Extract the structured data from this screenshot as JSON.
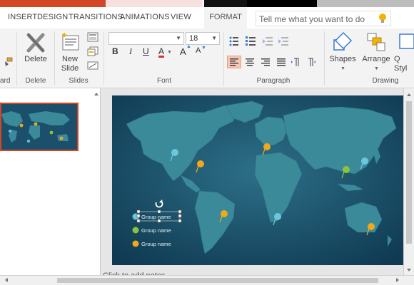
{
  "tabs": [
    "INSERT",
    "DESIGN",
    "TRANSITIONS",
    "ANIMATIONS",
    "VIEW"
  ],
  "active_tab": "FORMAT",
  "search": {
    "placeholder": "Tell me what you want to do"
  },
  "ribbon": {
    "clipboard_label": "ard",
    "delete_button": "Delete",
    "delete_group": "Delete",
    "new_slide_line1": "New",
    "new_slide_line2": "Slide",
    "slides_group": "Slides",
    "font_size": "18",
    "font_group": "Font",
    "bold": "B",
    "italic": "I",
    "underline": "U",
    "font_color": "A",
    "grow": "A",
    "shrink": "A",
    "paragraph_group": "Paragraph",
    "shapes": "Shapes",
    "arrange": "Arrange",
    "quick_styles": "Q\nStyl",
    "drawing_group": "Drawing"
  },
  "slide": {
    "legend": [
      "Group name",
      "Group name",
      "Group name"
    ],
    "legend_colors": [
      "#6cc7dd",
      "#8ac43f",
      "#f0a81d"
    ]
  },
  "notes_placeholder": "Click to add notes",
  "colors": {
    "accent": "#d24726",
    "ocean": "#1b4f6b",
    "land": "#3a8a9a"
  }
}
